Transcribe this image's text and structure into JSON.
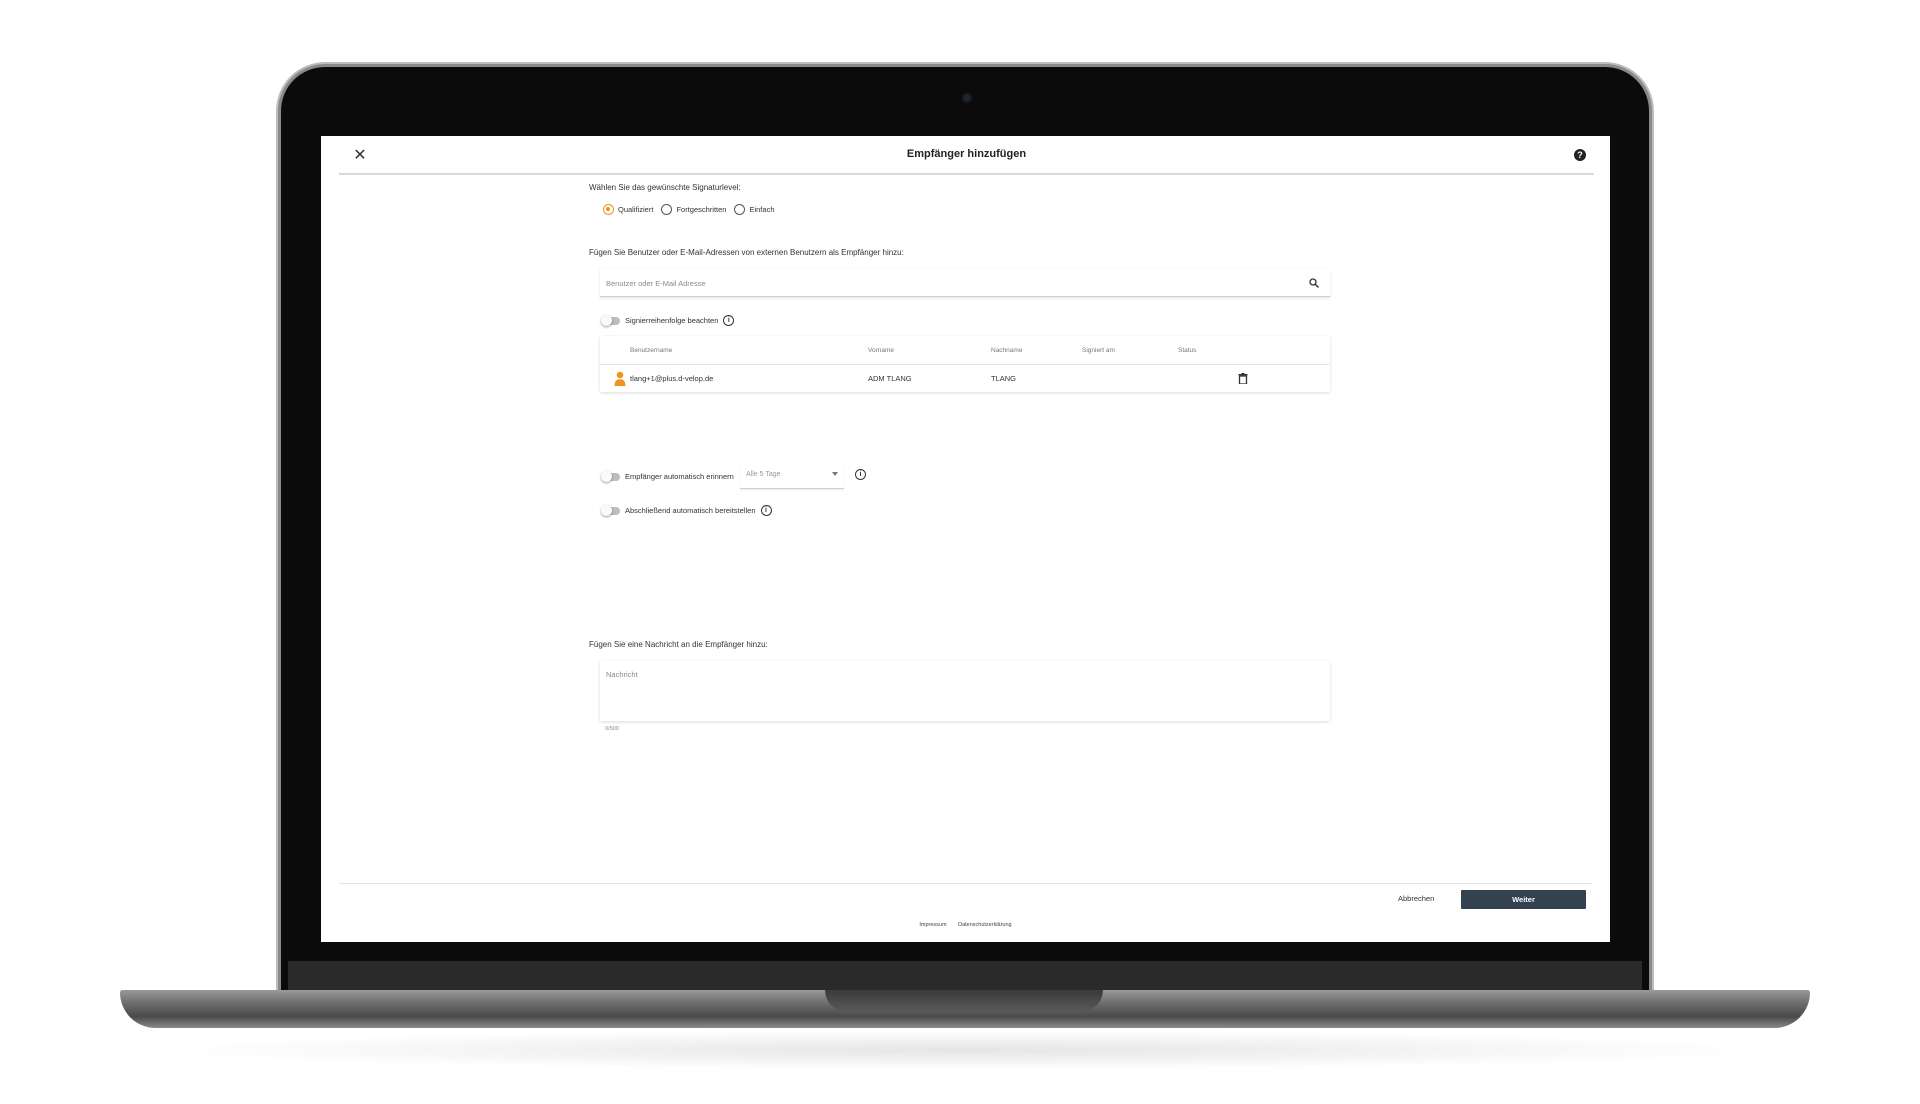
{
  "dialog": {
    "title": "Empfänger hinzufügen",
    "close_glyph": "✕",
    "help_glyph": "?"
  },
  "signature": {
    "label": "Wählen Sie das gewünschte Signaturlevel:",
    "options": [
      "Qualifiziert",
      "Fortgeschritten",
      "Einfach"
    ],
    "selected": "Qualifiziert"
  },
  "recipients": {
    "label": "Fügen Sie Benutzer oder E-Mail-Adressen von externen Benutzern als Empfänger hinzu:",
    "search_placeholder": "Benutzer oder E-Mail Adresse",
    "order_toggle_label": "Signierreihenfolge beachten",
    "table": {
      "headers": [
        "Benutzername",
        "Vorname",
        "Nachname",
        "Signiert am",
        "Status"
      ],
      "rows": [
        {
          "username": "tlang+1@plus.d-velop.de",
          "firstname": "ADM TLANG",
          "lastname": "TLANG",
          "signed": "",
          "status": ""
        }
      ]
    }
  },
  "reminder": {
    "label": "Empfänger automatisch erinnern",
    "interval": "Alle 5 Tage"
  },
  "provide": {
    "label": "Abschließend automatisch bereitstellen"
  },
  "message": {
    "label": "Fügen Sie eine Nachricht an die Empfänger hinzu:",
    "placeholder": "Nachricht",
    "counter": "0/500"
  },
  "footer": {
    "cancel": "Abbrechen",
    "next": "Weiter",
    "links": [
      "Impressum",
      "Datenschutzerklärung"
    ]
  },
  "colors": {
    "accent": "#f0941f",
    "primary_button": "#34414f"
  },
  "icons": {
    "close": "close-icon",
    "help": "help-icon",
    "search": "search-icon",
    "info": "info-icon",
    "user": "user-icon",
    "trash": "trash-icon",
    "caret": "chevron-down-icon"
  }
}
